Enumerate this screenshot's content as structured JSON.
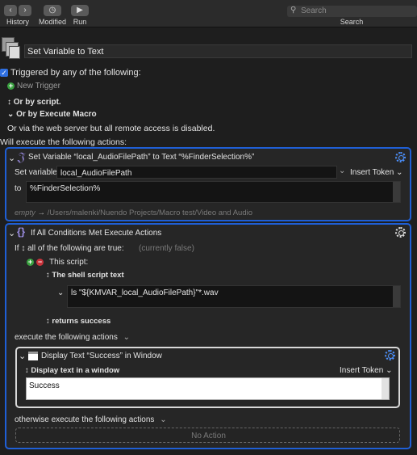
{
  "toolbar": {
    "history": "History",
    "modified": "Modified",
    "run": "Run",
    "search_placeholder": "Search",
    "search_label": "Search"
  },
  "macro": {
    "name": "Set Variable to Text",
    "triggered_by": "Triggered by any of the following:",
    "new_trigger": "New Trigger",
    "or_by_script": "Or by script.",
    "or_by_execute": "Or by Execute Macro",
    "web_server_note": "Or via the web server but all remote access is disabled.",
    "will_execute": "Will execute the following actions:"
  },
  "action1": {
    "title": "Set Variable “local_AudioFilePath” to Text “%FinderSelection%”",
    "set_variable_label": "Set variable",
    "variable_value": "local_AudioFilePath",
    "insert_token": "Insert Token",
    "to_label": "to",
    "text_value": "%FinderSelection%",
    "preview_empty": "empty",
    "preview_arrow": "→",
    "preview_path": "/Users/malenki/Nuendo Projects/Macro test/Video and Audio"
  },
  "action2": {
    "title": "If All Conditions Met Execute Actions",
    "if_label": "If",
    "all_following": "all of the following are true:",
    "currently": "(currently false)",
    "this_script": "This script:",
    "shell_script": "The shell script text",
    "script_value": "ls \"${KMVAR_local_AudioFilePath}\"*.wav",
    "returns": "returns success",
    "execute_following": "execute the following actions",
    "otherwise": "otherwise execute the following actions",
    "no_action": "No Action"
  },
  "action3": {
    "title": "Display Text “Success” in Window",
    "mode": "Display text in a window",
    "insert_token": "Insert Token",
    "text_value": "Success"
  },
  "colors": {
    "accent_blue": "#1f5fd6",
    "background": "#1e1e1e"
  }
}
